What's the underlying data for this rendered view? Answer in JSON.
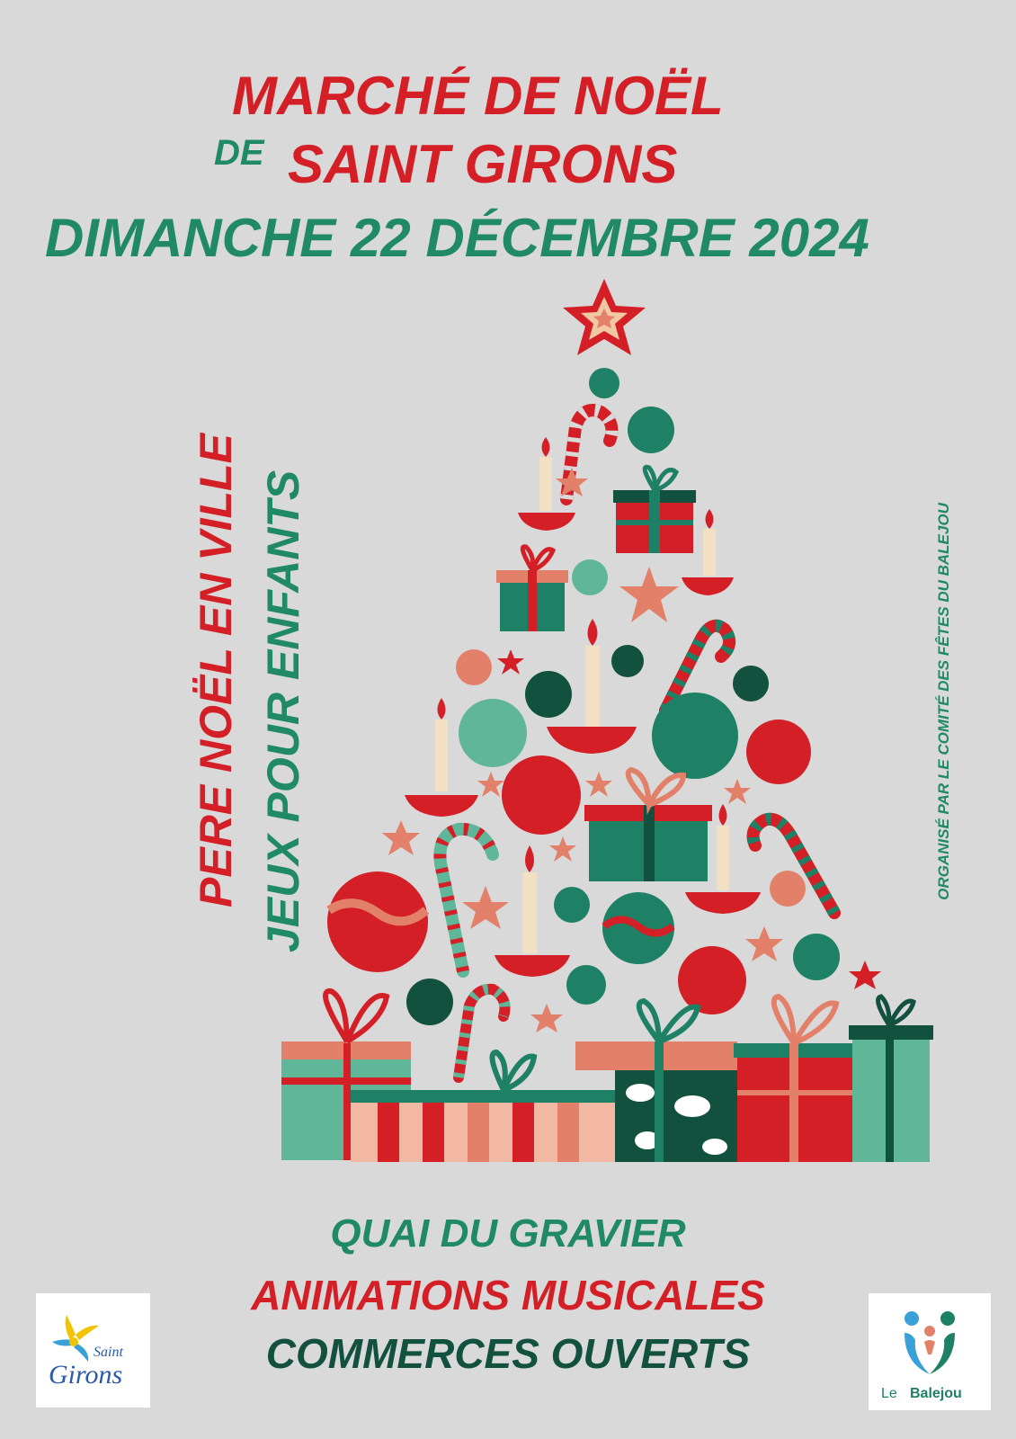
{
  "header": {
    "title_line1": "MARCHÉ DE NOËL",
    "title_de": "DE",
    "title_line2": "SAINT GIRONS",
    "date": "DIMANCHE 22 DÉCEMBRE 2024"
  },
  "side": {
    "pere_noel": "PERE NOËL EN VILLE",
    "jeux": "JEUX POUR ENFANTS",
    "organise": "ORGANISÉ PAR LE COMITÉ DES FÊTES DU BALEJOU"
  },
  "footer": {
    "location": "QUAI DU GRAVIER",
    "animations": "ANIMATIONS MUSICALES",
    "commerces": "COMMERCES OUVERTS"
  },
  "logos": {
    "saint_girons_small": "Saint",
    "saint_girons_big": "Girons",
    "balejou_prefix": "Le ",
    "balejou_name": "Balejou"
  },
  "colors": {
    "background": "#d9d9d9",
    "red": "#d41f26",
    "green": "#1f8a65",
    "dark_green": "#12513d",
    "salmon": "#e2806a"
  },
  "icons": [
    "star-icon",
    "bauble-icon",
    "candy-cane-icon",
    "gift-icon",
    "candle-icon"
  ]
}
